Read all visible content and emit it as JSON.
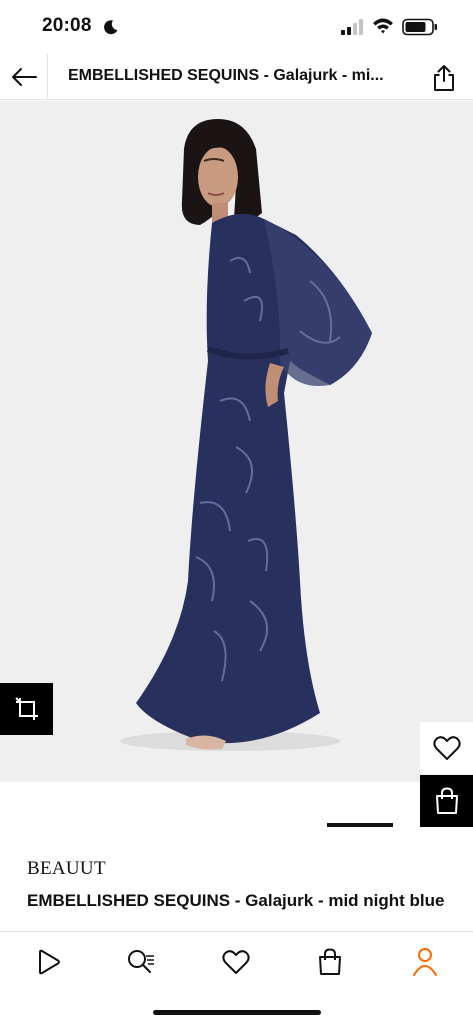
{
  "status_bar": {
    "time": "20:08",
    "icons": [
      "moon-icon",
      "signal-icon",
      "wifi-icon",
      "battery-icon"
    ]
  },
  "header": {
    "title": "EMBELLISHED SEQUINS - Galajurk - mi...",
    "back_icon": "arrow-left-icon",
    "share_icon": "share-icon"
  },
  "product": {
    "brand": "BEAUUT",
    "name": "EMBELLISHED SEQUINS - Galajurk - mid night blue",
    "image_alt": "model wearing embellished sequins evening dress",
    "colors": {
      "dress": "#28305e",
      "background": "#efefef"
    }
  },
  "actions": {
    "compare_icon": "compare-icon",
    "wishlist_icon": "heart-icon",
    "bag_icon": "shopping-bag-icon"
  },
  "bottom_nav": {
    "items": [
      {
        "icon": "play-icon"
      },
      {
        "icon": "search-list-icon"
      },
      {
        "icon": "heart-icon"
      },
      {
        "icon": "shopping-bag-icon"
      },
      {
        "icon": "profile-icon",
        "active_color": "#ff6900"
      }
    ]
  }
}
